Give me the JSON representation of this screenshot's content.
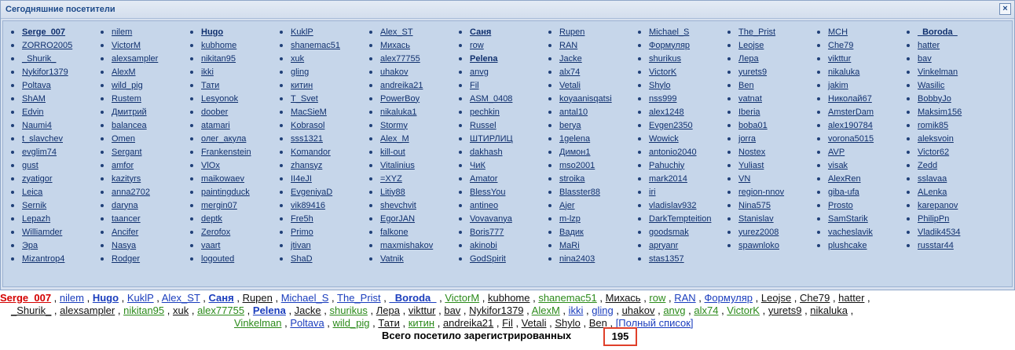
{
  "panel": {
    "title": "Сегодняшние посетители",
    "close": "×"
  },
  "grid": [
    [
      "Serge_007",
      "nilem",
      "Hugo",
      "KuklP",
      "Alex_ST",
      "Саня",
      "Rupen",
      "Michael_S",
      "The_Prist",
      "MCH",
      "_Boroda_"
    ],
    [
      "ZORRO2005",
      "VictorM",
      "kubhome",
      "shanemac51",
      "Михась",
      "row",
      "RAN",
      "Формуляр",
      "Leojse",
      "Che79",
      "hatter"
    ],
    [
      "_Shurik_",
      "alexsampler",
      "nikitan95",
      "xuk",
      "alex77755",
      "Pelena",
      "Jacke",
      "shurikus",
      "Лера",
      "vikttur",
      "bav"
    ],
    [
      "Nykifor1379",
      "AlexM",
      "ikki",
      "gling",
      "uhakov",
      "anvg",
      "alx74",
      "VictorK",
      "yurets9",
      "nikaluka",
      "Vinkelman"
    ],
    [
      "Poltava",
      "wild_pig",
      "Тати",
      "китин",
      "andreika21",
      "Fil",
      "Vetali",
      "Shylo",
      "Ben",
      "jakim",
      "Wasilic"
    ],
    [
      "ShAM",
      "Rustem",
      "Lesyonok",
      "T_Svet",
      "PowerBoy",
      "ASM_0408",
      "koyaanisqatsi",
      "nss999",
      "vatnat",
      "Николай67",
      "BobbyJo"
    ],
    [
      "Edvin",
      "Дмитрий",
      "doober",
      "MacSieM",
      "nikaluka1",
      "pechkin",
      "antal10",
      "alex1248",
      "Iberia",
      "AmsterDam",
      "Maksim156"
    ],
    [
      "Naumi4",
      "balancea",
      "atamari",
      "Kobrasol",
      "Stormy",
      "Russel",
      "berya",
      "Evgen2350",
      "boba01",
      "alex190784",
      "romik85"
    ],
    [
      "t_slavchev",
      "Omen",
      "олег_акула",
      "sss1321",
      "Alex_M",
      "ШТИРЛИЦ",
      "1gelena",
      "Wowick",
      "jorra",
      "vorona5015",
      "aleksvoin"
    ],
    [
      "evglim74",
      "Sergant",
      "Frankenstein",
      "Komandor",
      "kill-out",
      "dakhash",
      "Димон1",
      "antonio2040",
      "Nostex",
      "AVP",
      "Victor62"
    ],
    [
      "gust",
      "amfor",
      "VlOx",
      "zhansyz",
      "Vitalinius",
      "ЧиК",
      "mso2001",
      "Pahuchiy",
      "Yuliast",
      "visak",
      "Zedd"
    ],
    [
      "zyatigor",
      "kazityrs",
      "maikowaev",
      "II4eJI",
      "=XYZ",
      "Amator",
      "stroika",
      "mark2014",
      "VN",
      "AlexRen",
      "sslavaa"
    ],
    [
      "Leica",
      "anna2702",
      "paintingduck",
      "EvgeniyaD",
      "Litiy88",
      "BlessYou",
      "Blasster88",
      "iri",
      "region-nnov",
      "giba-ufa",
      "ALenka"
    ],
    [
      "Sernik",
      "daryna",
      "mergin07",
      "vik89416",
      "shevchvit",
      "antineo",
      "Ajer",
      "vladislav932",
      "Nina575",
      "Prosto",
      "karepanov"
    ],
    [
      "Lepazh",
      "taancer",
      "deptk",
      "Fre5h",
      "EgorJAN",
      "Vovavanya",
      "m-lzp",
      "DarkTempteition",
      "Stanislav",
      "SamStarik",
      "PhilipPn"
    ],
    [
      "Williamder",
      "Ancifer",
      "Zerofox",
      "Primo",
      "falkone",
      "Boris777",
      "Вадик",
      "goodsmak",
      "yurez2008",
      "vacheslavik",
      "Vladik4534"
    ],
    [
      "Эра",
      "Nasya",
      "vaart",
      "jtivan",
      "maxmishakov",
      "akinobi",
      "MaRi",
      "apryanr",
      "spawnloko",
      "plushcake",
      "russtar44"
    ],
    [
      "Mizantrop4",
      "Rodger",
      "logouted",
      "ShaD",
      "Vatnik",
      "GodSpirit",
      "nina2403",
      "stas1357",
      "",
      "",
      ""
    ]
  ],
  "bold_names": [
    "Serge_007",
    "Hugo",
    "Саня",
    "_Boroda_",
    "Pelena"
  ],
  "bottom_lines": [
    [
      [
        "Serge_007",
        "red"
      ],
      [
        "nilem",
        "blue"
      ],
      [
        "Hugo",
        "blueb"
      ],
      [
        "KuklP",
        "blue"
      ],
      [
        "Alex_ST",
        "blue"
      ],
      [
        "Саня",
        "navyb"
      ],
      [
        "Rupen",
        "black"
      ],
      [
        "Michael_S",
        "blue"
      ],
      [
        "The_Prist",
        "blue"
      ],
      [
        "_Boroda_",
        "navyb"
      ],
      [
        "VictorM",
        "green"
      ],
      [
        "kubhome",
        "black"
      ],
      [
        "shanemac51",
        "green"
      ],
      [
        "Михась",
        "black"
      ],
      [
        "row",
        "green"
      ],
      [
        "RAN",
        "blue"
      ],
      [
        "Формуляр",
        "blue"
      ],
      [
        "Leojse",
        "black"
      ],
      [
        "Che79",
        "black"
      ],
      [
        "hatter",
        "black"
      ]
    ],
    [
      [
        "_Shurik_",
        "black"
      ],
      [
        "alexsampler",
        "black"
      ],
      [
        "nikitan95",
        "green"
      ],
      [
        "xuk",
        "black"
      ],
      [
        "alex77755",
        "green"
      ],
      [
        "Pelena",
        "navyb"
      ],
      [
        "Jacke",
        "black"
      ],
      [
        "shurikus",
        "green"
      ],
      [
        "Лера",
        "black"
      ],
      [
        "vikttur",
        "black"
      ],
      [
        "bav",
        "black"
      ],
      [
        "Nykifor1379",
        "black"
      ],
      [
        "AlexM",
        "green"
      ],
      [
        "ikki",
        "blue"
      ],
      [
        "gling",
        "blue"
      ],
      [
        "uhakov",
        "black"
      ],
      [
        "anvg",
        "green"
      ],
      [
        "alx74",
        "green"
      ],
      [
        "VictorK",
        "green"
      ],
      [
        "yurets9",
        "black"
      ],
      [
        "nikaluka",
        "black"
      ]
    ],
    [
      [
        "Vinkelman",
        "green"
      ],
      [
        "Poltava",
        "blue"
      ],
      [
        "wild_pig",
        "green"
      ],
      [
        "Тати",
        "black"
      ],
      [
        "китин",
        "green"
      ],
      [
        "andreika21",
        "black"
      ],
      [
        "Fil",
        "black"
      ],
      [
        "Vetali",
        "black"
      ],
      [
        "Shylo",
        "black"
      ],
      [
        "Ben",
        "black"
      ]
    ]
  ],
  "full_list": "[Полный список]",
  "total": {
    "label": "Всего посетило зарегистрированных",
    "count": "195"
  },
  "colors": {
    "panel_bg": "#c6d6ea",
    "link": "#10306e",
    "highlight": "#e0402a"
  }
}
